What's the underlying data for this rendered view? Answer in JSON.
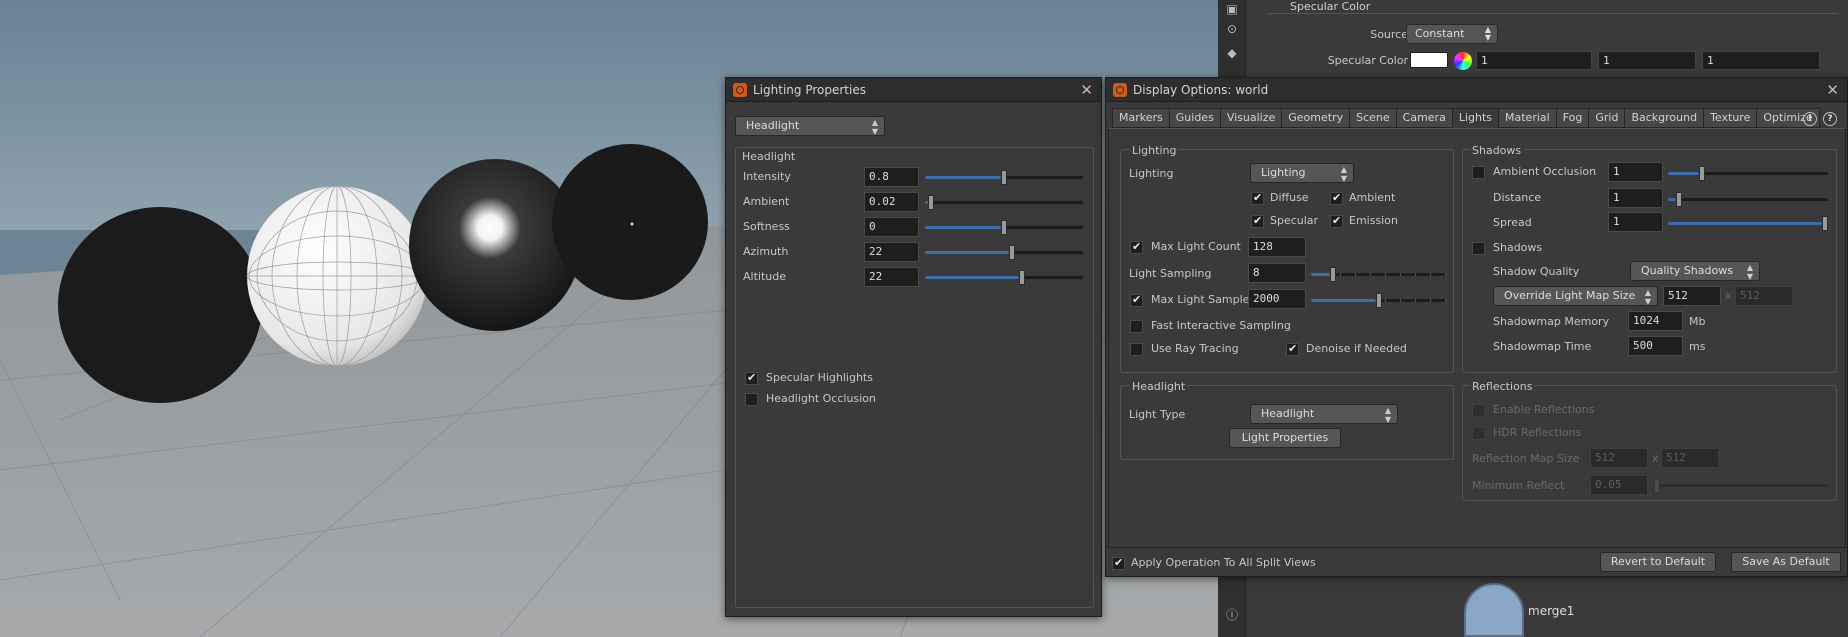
{
  "param_pane": {
    "section_header": "Specular Color",
    "source_label": "Source",
    "source_value": "Constant",
    "specular_color_label": "Specular Color",
    "specular_values": [
      "1",
      "1",
      "1"
    ],
    "swatch_color": "#ffffff"
  },
  "network": {
    "node_label": "merge1"
  },
  "lighting_properties": {
    "title": "Lighting Properties",
    "mode_value": "Headlight",
    "group_title": "Headlight",
    "params": [
      {
        "label": "Intensity",
        "value": "0.8",
        "fraction": 0.5
      },
      {
        "label": "Ambient",
        "value": "0.02",
        "fraction": 0.02
      },
      {
        "label": "Softness",
        "value": "0",
        "fraction": 0.5
      },
      {
        "label": "Azimuth",
        "value": "22",
        "fraction": 0.55
      },
      {
        "label": "Altitude",
        "value": "22",
        "fraction": 0.62
      }
    ],
    "specular_highlights": {
      "label": "Specular Highlights",
      "checked": true
    },
    "headlight_occlusion": {
      "label": "Headlight Occlusion",
      "checked": false
    }
  },
  "display_options": {
    "title": "Display Options:",
    "title_object": "world",
    "tabs": [
      "Markers",
      "Guides",
      "Visualize",
      "Geometry",
      "Scene",
      "Camera",
      "Lights",
      "Material",
      "Fog",
      "Grid",
      "Background",
      "Texture",
      "Optimize"
    ],
    "active_tab": "Lights",
    "lighting": {
      "group_title": "Lighting",
      "lighting_label": "Lighting",
      "lighting_value": "Lighting",
      "diffuse": "Diffuse",
      "ambient": "Ambient",
      "specular": "Specular",
      "emission": "Emission",
      "max_light_count_label": "Max Light Count",
      "max_light_count_value": "128",
      "light_sampling_label": "Light Sampling",
      "light_sampling_value": "8",
      "light_sampling_fraction": 0.15,
      "max_light_samples_label": "Max Light Samples",
      "max_light_samples_value": "2000",
      "max_light_samples_fraction": 0.5,
      "fast_interactive_label": "Fast Interactive Sampling",
      "use_ray_tracing_label": "Use Ray Tracing",
      "denoise_label": "Denoise if Needed"
    },
    "shadows": {
      "group_title": "Shadows",
      "ambient_occlusion_label": "Ambient Occlusion",
      "ambient_occlusion_value": "1",
      "ambient_occlusion_fraction": 0.2,
      "distance_label": "Distance",
      "distance_value": "1",
      "distance_fraction": 0.05,
      "spread_label": "Spread",
      "spread_value": "1",
      "spread_fraction": 1.0,
      "shadows_label": "Shadows",
      "shadow_quality_label": "Shadow Quality",
      "shadow_quality_value": "Quality Shadows",
      "override_label": "Override Light Map Size",
      "map_size_x": "512",
      "map_size_y": "512",
      "x_sep": "x",
      "memory_label": "Shadowmap Memory",
      "memory_value": "1024",
      "memory_unit": "Mb",
      "time_label": "Shadowmap Time",
      "time_value": "500",
      "time_unit": "ms"
    },
    "headlight": {
      "group_title": "Headlight",
      "light_type_label": "Light Type",
      "light_type_value": "Headlight",
      "light_properties_button": "Light Properties"
    },
    "reflections": {
      "group_title": "Reflections",
      "enable_label": "Enable Reflections",
      "hdr_label": "HDR Reflections",
      "map_size_label": "Reflection Map Size",
      "map_size_x": "512",
      "map_size_y": "512",
      "x_sep": "x",
      "min_reflect_label": "Minimum Reflect",
      "min_reflect_value": "0.05"
    },
    "apply_all_label": "Apply Operation To All Split Views",
    "revert_button": "Revert to Default",
    "save_button": "Save As Default"
  }
}
